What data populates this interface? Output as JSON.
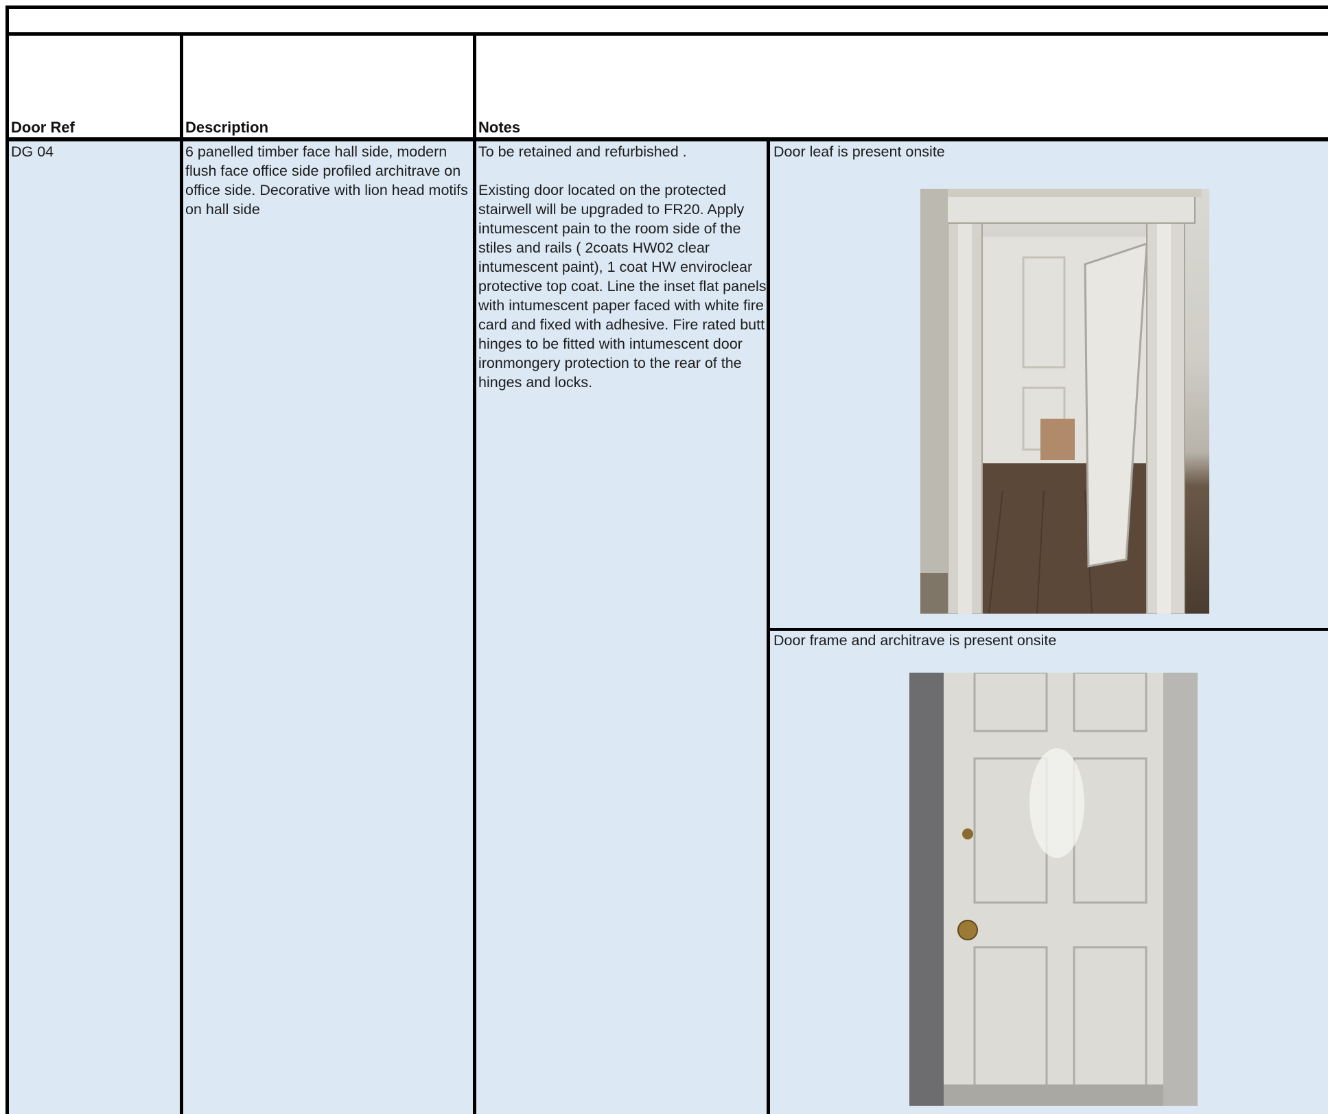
{
  "headers": {
    "door_ref": "Door Ref",
    "description": "Description",
    "notes": "Notes"
  },
  "row": {
    "door_ref": "DG 04",
    "description": "6 panelled timber face hall side, modern flush face office side profiled architrave on office side. Decorative with lion head motifs on hall side",
    "notes_line1": "To be retained and refurbished .",
    "notes_body": "Existing door located on the protected stairwell will be upgraded to FR20. Apply intumescent pain to the room side of the stiles and rails ( 2coats HW02 clear intumescent paint), 1 coat HW enviroclear protective top coat. Line the inset flat panels with intumescent paper faced with white fire card and fixed with adhesive. Fire rated butt hinges to be fitted with intumescent door ironmongery protection to the rear of the hinges and locks."
  },
  "photos": [
    {
      "caption": "Door leaf is present onsite"
    },
    {
      "caption": "Door frame and architrave is present onsite"
    }
  ],
  "colors": {
    "cell_fill": "#dce8f4",
    "border": "#000000"
  }
}
